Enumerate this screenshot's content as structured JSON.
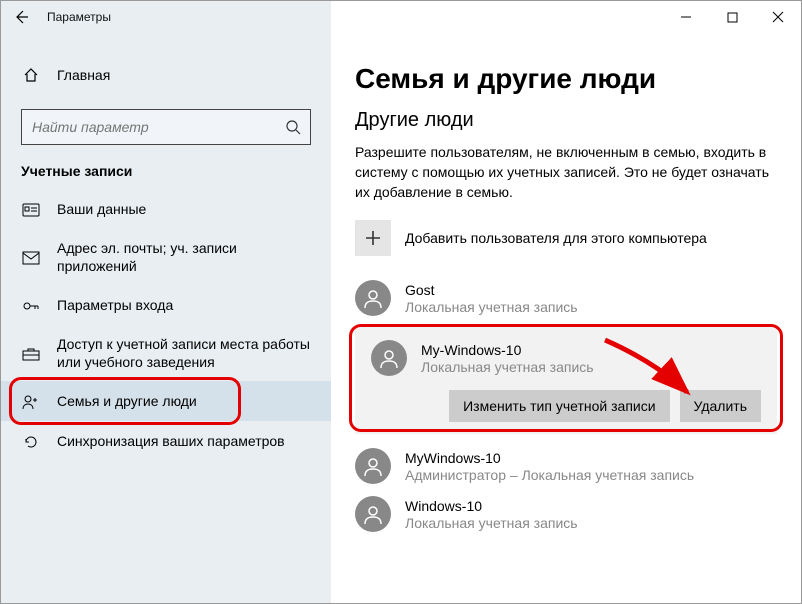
{
  "window": {
    "title": "Параметры"
  },
  "home": {
    "label": "Главная"
  },
  "search": {
    "placeholder": "Найти параметр"
  },
  "sidebar": {
    "heading": "Учетные записи",
    "items": [
      {
        "label": "Ваши данные"
      },
      {
        "label": "Адрес эл. почты; уч. записи приложений"
      },
      {
        "label": "Параметры входа"
      },
      {
        "label": "Доступ к учетной записи места работы или учебного заведения"
      },
      {
        "label": "Семья и другие люди"
      },
      {
        "label": "Синхронизация ваших параметров"
      }
    ]
  },
  "main": {
    "title": "Семья и другие люди",
    "subtitle": "Другие люди",
    "description": "Разрешите пользователям, не включенным в семью, входить в систему с помощью их учетных записей. Это не будет означать их добавление в семью.",
    "add_label": "Добавить пользователя для этого компьютера",
    "users": [
      {
        "name": "Gost",
        "type": "Локальная учетная запись"
      },
      {
        "name": "My-Windows-10",
        "type": "Локальная учетная запись"
      },
      {
        "name": "MyWindows-10",
        "type": "Администратор  –  Локальная учетная запись"
      },
      {
        "name": "Windows-10",
        "type": "Локальная учетная запись"
      }
    ],
    "buttons": {
      "change_type": "Изменить тип учетной записи",
      "remove": "Удалить"
    }
  }
}
